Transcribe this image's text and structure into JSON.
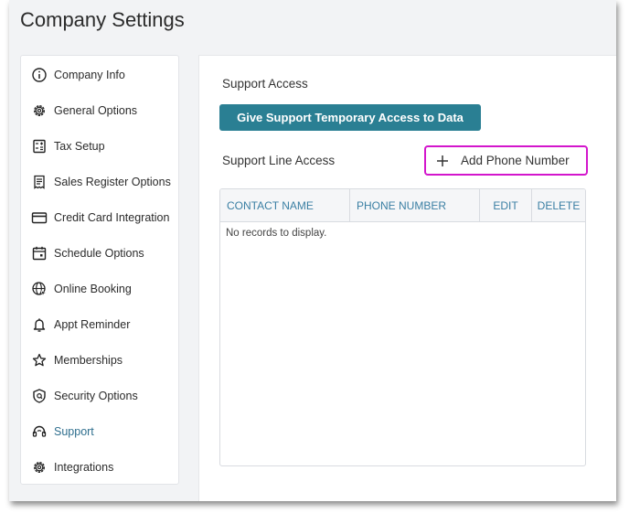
{
  "page": {
    "title": "Company Settings"
  },
  "sidebar": {
    "items": [
      {
        "label": "Company Info",
        "icon": "info-circle-icon"
      },
      {
        "label": "General Options",
        "icon": "gear-icon"
      },
      {
        "label": "Tax Setup",
        "icon": "calculator-icon"
      },
      {
        "label": "Sales Register Options",
        "icon": "receipt-icon"
      },
      {
        "label": "Credit Card Integration",
        "icon": "credit-card-icon"
      },
      {
        "label": "Schedule Options",
        "icon": "calendar-icon"
      },
      {
        "label": "Online Booking",
        "icon": "globe-cursor-icon"
      },
      {
        "label": "Appt Reminder",
        "icon": "bell-icon"
      },
      {
        "label": "Memberships",
        "icon": "star-icon"
      },
      {
        "label": "Security Options",
        "icon": "shield-icon"
      },
      {
        "label": "Support",
        "icon": "headset-icon",
        "active": true
      },
      {
        "label": "Integrations",
        "icon": "gear-icon"
      }
    ]
  },
  "main": {
    "support_access_title": "Support Access",
    "support_access_button": "Give Support Temporary Access to Data",
    "support_line_title": "Support Line Access",
    "add_phone_button": "Add Phone Number",
    "table": {
      "columns": [
        "CONTACT NAME",
        "PHONE NUMBER",
        "EDIT",
        "DELETE"
      ],
      "empty_message": "No records to display."
    }
  },
  "colors": {
    "accent": "#2a7f93",
    "highlight_border": "#d316cc",
    "active_text": "#2f6f8e",
    "header_text": "#3a7fa3"
  }
}
